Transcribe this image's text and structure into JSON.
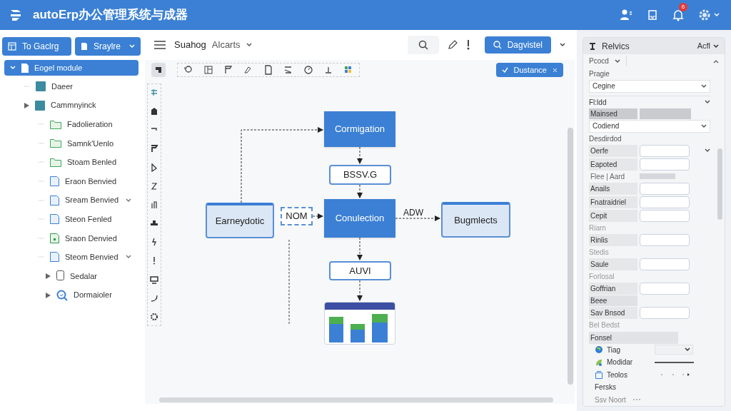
{
  "header": {
    "title": "autoErp办公管理系统与成器",
    "notification_count": "6"
  },
  "left_buttons": [
    {
      "label": "To Gaclrg",
      "dropdown": false
    },
    {
      "label": "Sraylre",
      "dropdown": true
    }
  ],
  "tree": [
    {
      "label": "Eogel module",
      "kind": "file",
      "selected": true,
      "caret": false,
      "chevron": false,
      "children": [
        {
          "label": "Daeer",
          "kind": "module",
          "selected": false,
          "caret": false,
          "chevron": false
        },
        {
          "label": "Cammnyinck",
          "kind": "module",
          "selected": false,
          "caret": true,
          "chevron": false,
          "children": [
            {
              "label": "Fadolieration",
              "kind": "folder",
              "selected": false,
              "caret": false,
              "chevron": false
            },
            {
              "label": "Samnk'Uenlo",
              "kind": "folder",
              "selected": false,
              "caret": false,
              "chevron": false
            },
            {
              "label": "Stoam Benled",
              "kind": "folder",
              "selected": false,
              "caret": false,
              "chevron": false
            },
            {
              "label": "Eraon Benvied",
              "kind": "doc",
              "selected": false,
              "caret": false,
              "chevron": false
            },
            {
              "label": "Sream Benvied",
              "kind": "doc",
              "selected": false,
              "caret": false,
              "chevron": true
            },
            {
              "label": "Steon Fenled",
              "kind": "doc",
              "selected": false,
              "caret": false,
              "chevron": false
            },
            {
              "label": "Sraon Denvied",
              "kind": "greendoc",
              "selected": false,
              "caret": false,
              "chevron": false
            },
            {
              "label": "Steom Benvied",
              "kind": "doc",
              "selected": false,
              "caret": false,
              "chevron": true
            },
            {
              "label": "Sedalar",
              "kind": "device",
              "selected": false,
              "caret": true,
              "chevron": false
            },
            {
              "label": "Dormaioler",
              "kind": "search",
              "selected": false,
              "caret": true,
              "chevron": false
            }
          ]
        }
      ]
    }
  ],
  "toolbar": {
    "title": "Suahog",
    "menu": "Alcarts",
    "primary_button": "Dagvistel"
  },
  "canvas": {
    "action_button": "Dustance",
    "nodes": [
      {
        "label": "Cormigation",
        "kind": "primary"
      },
      {
        "label": "BSSV.G",
        "kind": "plain"
      },
      {
        "label": "Conulection",
        "kind": "primary"
      },
      {
        "label": "Earneydotic",
        "kind": "light"
      },
      {
        "label": "NOM",
        "kind": "dashed"
      },
      {
        "label": "Bugmlects",
        "kind": "light"
      },
      {
        "label": "AUVI",
        "kind": "plain"
      },
      {
        "kind": "thumbnail"
      }
    ],
    "edge_label": "ADW"
  },
  "properties": {
    "title": "Relvics",
    "action": "Acfl",
    "tab": "Pcocd",
    "rows": [
      {
        "label": "Pragie",
        "kind": "label"
      },
      {
        "label": "Cegine",
        "kind": "select"
      },
      {
        "label": "Fl:ldd",
        "kind": "section"
      },
      {
        "label": "Mainsed",
        "kind": "shaded"
      },
      {
        "label": "Codiend",
        "kind": "select"
      },
      {
        "label": "Desdirdod",
        "kind": "label"
      },
      {
        "label": "Oerfe",
        "kind": "input-caret"
      },
      {
        "label": "Eapoted",
        "kind": "input"
      },
      {
        "label": "Flee | Aard",
        "kind": "disabled"
      },
      {
        "label": "Anails",
        "kind": "input"
      },
      {
        "label": "Fnatraidriel",
        "kind": "input"
      },
      {
        "label": "Cepit",
        "kind": "input"
      },
      {
        "label": "Riarn",
        "kind": "muted"
      },
      {
        "label": "Rinlis",
        "kind": "input"
      },
      {
        "label": "Stedis",
        "kind": "muted"
      },
      {
        "label": "Saule",
        "kind": "input"
      },
      {
        "label": "Forlosal",
        "kind": "muted"
      },
      {
        "label": "Goffrian",
        "kind": "input"
      },
      {
        "label": "Beee",
        "kind": "shaded-empty"
      },
      {
        "label": "Sav Bnsod",
        "kind": "input"
      },
      {
        "label": "Bel Bedst",
        "kind": "muted"
      },
      {
        "label": "Fonsel",
        "kind": "group"
      },
      {
        "label": "Tiag",
        "kind": "item-select"
      },
      {
        "label": "Modidar",
        "kind": "item-line"
      },
      {
        "label": "Teolos",
        "kind": "item-dots"
      },
      {
        "label": "Fersks",
        "kind": "item-plain"
      },
      {
        "label": "Ssv Noort",
        "kind": "item-muted"
      }
    ]
  }
}
